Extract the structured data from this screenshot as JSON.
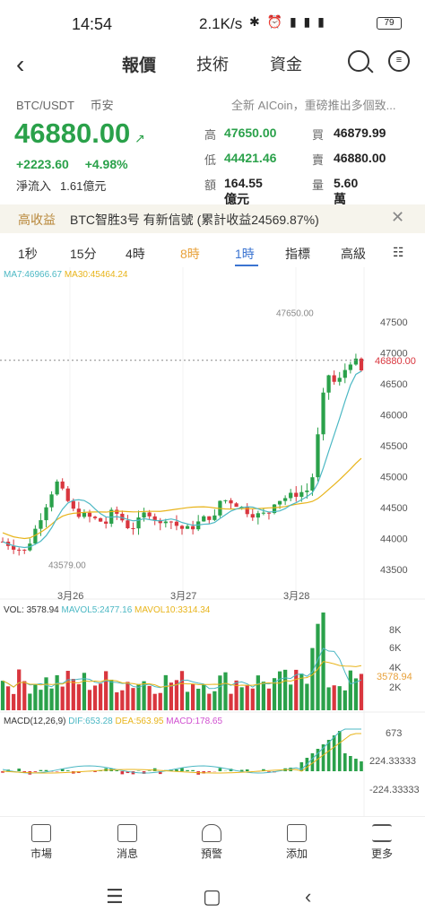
{
  "status_bar": {
    "time": "14:54",
    "network_speed": "2.1K/s",
    "battery": "79"
  },
  "nav": {
    "tabs": [
      "報價",
      "技術",
      "資金"
    ]
  },
  "pair": {
    "symbol": "BTC/USDT",
    "exchange": "币安"
  },
  "news_ticker": "全新 AICoin，重磅推出多個致...",
  "price": "46880.00",
  "change_abs": "+2223.60",
  "change_pct": "+4.98%",
  "inflow_label": "淨流入",
  "inflow_value": "1.61億元",
  "stats": {
    "high_label": "高",
    "high": "47650.00",
    "low_label": "低",
    "low": "44421.46",
    "amount_label": "額",
    "amount": "164.55億元",
    "bid_label": "買",
    "bid": "46879.99",
    "ask_label": "賣",
    "ask": "46880.00",
    "volume_label": "量",
    "volume": "5.60萬"
  },
  "banner": {
    "tag": "高收益",
    "text": "BTC智胜3号 有新信號 (累計收益24569.87%)"
  },
  "timeframes": [
    "1秒",
    "15分",
    "4時",
    "8時",
    "1時",
    "指標",
    "高級"
  ],
  "indicators": {
    "ma7": "MA7:46966.67",
    "ma30": "MA30:45464.24",
    "vol": "VOL: 3578.94",
    "mavol5": "MAVOL5:2477.16",
    "mavol10": "MAVOL10:3314.34",
    "macd_params": "MACD(12,26,9)",
    "dif": "DIF:653.28",
    "dea": "DEA:563.95",
    "macd": "MACD:178.65"
  },
  "bottom_nav": [
    "市場",
    "消息",
    "預警",
    "添加",
    "更多"
  ],
  "chart_data": {
    "type": "candlestick",
    "price_axis": [
      47500,
      47000,
      46500,
      46000,
      45500,
      45000,
      44500,
      44000,
      43500
    ],
    "high_marker": "47650.00",
    "low_marker": "43579.00",
    "current_label": "46880.00",
    "date_labels": [
      "3月26",
      "3月27",
      "3月28"
    ],
    "volume_axis": [
      "8K",
      "6K",
      "4K",
      "2K"
    ],
    "volume_current": "3578.94",
    "macd_axis": [
      "673",
      "224.33333",
      "-224.33333"
    ],
    "colors": {
      "up": "#2aa14a",
      "down": "#d9363e",
      "ma7": "#4cb8c4",
      "ma30": "#e8b41a",
      "macd_line": "#d04fd0"
    }
  }
}
